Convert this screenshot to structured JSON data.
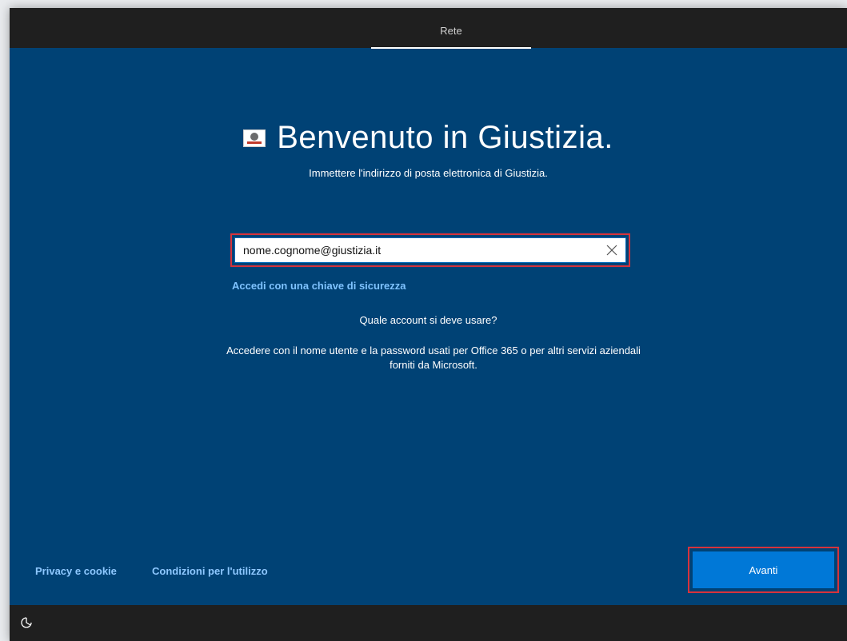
{
  "header": {
    "tab_label": "Rete"
  },
  "main": {
    "title": "Benvenuto in Giustizia.",
    "subtitle": "Immettere l'indirizzo di posta elettronica di Giustizia.",
    "email_value": "nome.cognome@giustizia.it",
    "security_key_link": "Accedi con una chiave di sicurezza",
    "which_account": "Quale account si deve usare?",
    "help_line1": "Accedere con il nome utente e la password usati per Office 365 o per altri servizi aziendali",
    "help_line2": "forniti da Microsoft."
  },
  "footer": {
    "privacy_link": "Privacy e cookie",
    "terms_link": "Condizioni per l'utilizzo",
    "next_button": "Avanti"
  },
  "icons": {
    "logo": "italian-emblem-icon",
    "clear": "close-icon",
    "accessibility": "ease-of-access-icon"
  },
  "colors": {
    "background": "#004275",
    "bars": "#1f1f1f",
    "accent_button": "#0078d7",
    "link": "#7fc3ff",
    "highlight": "#d6333c"
  }
}
